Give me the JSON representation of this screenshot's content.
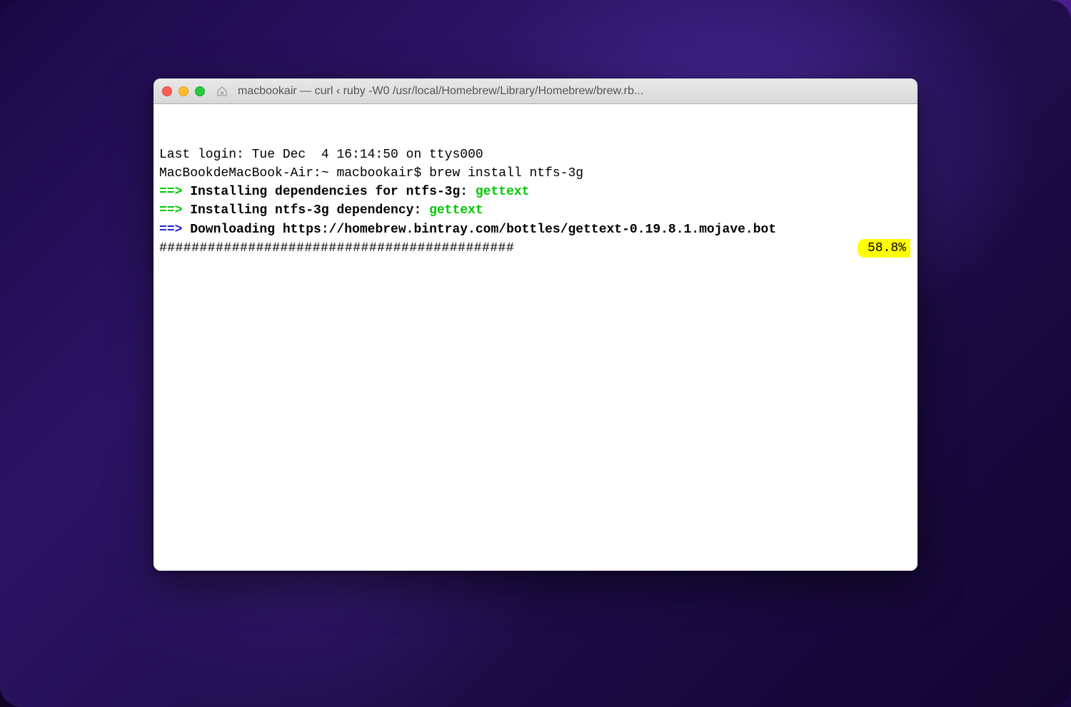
{
  "window": {
    "title": "macbookair — curl ‹ ruby -W0 /usr/local/Homebrew/Library/Homebrew/brew.rb..."
  },
  "terminal": {
    "last_login": "Last login: Tue Dec  4 16:14:50 on ttys000",
    "prompt": "MacBookdeMacBook-Air:~ macbookair$ ",
    "command": "brew install ntfs-3g",
    "line1_arrow": "==>",
    "line1_text": " Installing dependencies for ntfs-3g: ",
    "line1_dep": "gettext",
    "line2_arrow": "==>",
    "line2_text": " Installing ntfs-3g dependency: ",
    "line2_dep": "gettext",
    "line3_arrow": "==>",
    "line3_text": " Downloading https://homebrew.bintray.com/bottles/gettext-0.19.8.1.mojave.bot",
    "progress_hashes": "############################################",
    "progress_percent": "58.8%"
  }
}
